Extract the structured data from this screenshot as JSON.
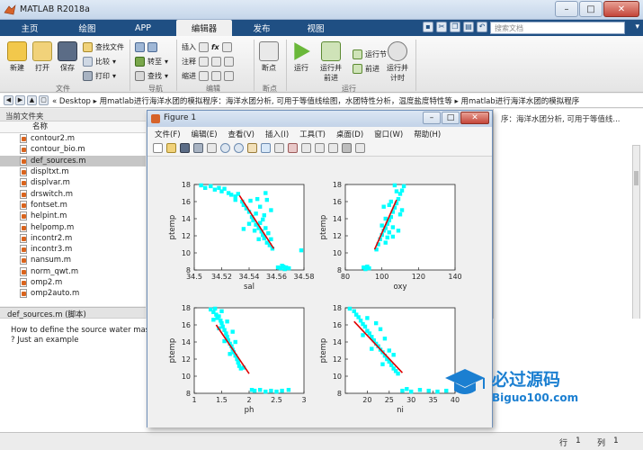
{
  "window": {
    "title": "MATLAB R2018a"
  },
  "tabs": [
    {
      "label": "主页"
    },
    {
      "label": "绘图"
    },
    {
      "label": "APP"
    },
    {
      "label": "编辑器"
    },
    {
      "label": "发布"
    },
    {
      "label": "视图"
    }
  ],
  "search": {
    "placeholder": "搜索文档"
  },
  "ribbon": {
    "file": {
      "new": "新建",
      "open": "打开",
      "save": "保存",
      "find_file": "查找文件",
      "compare": "比较",
      "print": "打印",
      "group": "文件"
    },
    "nav": {
      "goto": "转至",
      "find": "查找",
      "group": "导航"
    },
    "edit": {
      "insert": "插入",
      "comment": "注释",
      "indent": "缩进",
      "fx": "fx",
      "group": "编辑"
    },
    "breakpoint": {
      "label": "断点",
      "group": "断点"
    },
    "run": {
      "run": "运行",
      "run_advance": "运行并\n前进",
      "run_section": "运行节",
      "advance": "前进",
      "run_time": "运行并\n计时",
      "group": "运行"
    }
  },
  "address": {
    "path": "« Desktop ▸ 用matlab进行海洋水团的模拟程序：海洋水团分析, 可用于等值线绘图，水团特性分析，温度盐度特性等 ▸ 用matlab进行海洋水团的模拟程序"
  },
  "current_folder": {
    "title": "当前文件夹",
    "column": "名称",
    "files": [
      "contour2.m",
      "contour_bio.m",
      "def_sources.m",
      "displtxt.m",
      "displvar.m",
      "drswitch.m",
      "fontset.m",
      "helpint.m",
      "helpomp.m",
      "incontr2.m",
      "incontr3.m",
      "nansum.m",
      "norm_qwt.m",
      "omp2.m",
      "omp2auto.m"
    ],
    "selected_index": 2
  },
  "details": {
    "header": "def_sources.m  (脚本)",
    "lines": [
      "How to define the source water masse",
      "? Just an example"
    ]
  },
  "right_pane": {
    "text": "序：海洋水团分析, 可用于等值线..."
  },
  "status": {
    "row_label": "行",
    "row": "1",
    "col_label": "列",
    "col": "1"
  },
  "figure": {
    "title": "Figure 1",
    "menu": [
      "文件(F)",
      "编辑(E)",
      "查看(V)",
      "插入(I)",
      "工具(T)",
      "桌面(D)",
      "窗口(W)",
      "帮助(H)"
    ]
  },
  "watermark": {
    "main": "必过源码",
    "sub": "Biguo100.com"
  },
  "colors": {
    "ribbon_blue": "#1f4f83",
    "points": "#00ffff",
    "fit_line": "#e00000"
  },
  "chart_data": [
    {
      "type": "scatter",
      "xlabel": "sal",
      "ylabel": "ptemp",
      "xlim": [
        34.5,
        34.58
      ],
      "ylim": [
        8,
        18
      ],
      "xticks": [
        "34.5",
        "34.52",
        "34.54",
        "34.56",
        "34.58"
      ],
      "yticks": [
        "8",
        "10",
        "12",
        "14",
        "16",
        "18"
      ],
      "fit": [
        [
          34.533,
          16.7
        ],
        [
          34.558,
          10.5
        ]
      ],
      "points": [
        [
          34.505,
          17.9
        ],
        [
          34.508,
          17.6
        ],
        [
          34.512,
          17.8
        ],
        [
          34.515,
          17.4
        ],
        [
          34.518,
          17.6
        ],
        [
          34.52,
          17.2
        ],
        [
          34.522,
          17.5
        ],
        [
          34.525,
          17.0
        ],
        [
          34.527,
          16.8
        ],
        [
          34.53,
          16.6
        ],
        [
          34.53,
          16.2
        ],
        [
          34.532,
          16.9
        ],
        [
          34.535,
          16.0
        ],
        [
          34.536,
          15.6
        ],
        [
          34.538,
          15.2
        ],
        [
          34.54,
          14.8
        ],
        [
          34.541,
          16.1
        ],
        [
          34.542,
          14.2
        ],
        [
          34.543,
          13.8
        ],
        [
          34.545,
          13.3
        ],
        [
          34.545,
          14.6
        ],
        [
          34.547,
          12.9
        ],
        [
          34.548,
          13.5
        ],
        [
          34.549,
          12.5
        ],
        [
          34.55,
          12.1
        ],
        [
          34.55,
          13.9
        ],
        [
          34.551,
          11.7
        ],
        [
          34.552,
          12.9
        ],
        [
          34.553,
          11.2
        ],
        [
          34.554,
          12.3
        ],
        [
          34.555,
          10.9
        ],
        [
          34.556,
          11.6
        ],
        [
          34.557,
          10.5
        ],
        [
          34.548,
          15.4
        ],
        [
          34.546,
          16.3
        ],
        [
          34.552,
          17.0
        ],
        [
          34.553,
          16.2
        ],
        [
          34.556,
          15.0
        ],
        [
          34.551,
          14.4
        ],
        [
          34.544,
          12.6
        ],
        [
          34.547,
          11.6
        ],
        [
          34.54,
          13.4
        ],
        [
          34.536,
          12.8
        ],
        [
          34.561,
          8.3
        ],
        [
          34.563,
          8.2
        ],
        [
          34.565,
          8.4
        ],
        [
          34.567,
          8.3
        ],
        [
          34.569,
          8.2
        ],
        [
          34.564,
          8.5
        ],
        [
          34.566,
          8.1
        ],
        [
          34.578,
          10.3
        ]
      ]
    },
    {
      "type": "scatter",
      "xlabel": "oxy",
      "ylabel": "ptemp",
      "xlim": [
        80,
        140
      ],
      "ylim": [
        8,
        18
      ],
      "xticks": [
        "80",
        "100",
        "120",
        "140"
      ],
      "yticks": [
        "8",
        "10",
        "12",
        "14",
        "16",
        "18"
      ],
      "fit": [
        [
          96,
          10.4
        ],
        [
          108,
          16.2
        ]
      ],
      "points": [
        [
          90,
          8.3
        ],
        [
          91,
          8.1
        ],
        [
          92,
          8.4
        ],
        [
          93,
          8.2
        ],
        [
          97,
          10.4
        ],
        [
          98,
          11.0
        ],
        [
          99,
          11.6
        ],
        [
          100,
          12.1
        ],
        [
          101,
          12.6
        ],
        [
          102,
          12.9
        ],
        [
          103,
          13.4
        ],
        [
          104,
          13.8
        ],
        [
          105,
          14.2
        ],
        [
          106,
          14.8
        ],
        [
          107,
          15.3
        ],
        [
          108,
          15.8
        ],
        [
          109,
          16.3
        ],
        [
          110,
          16.9
        ],
        [
          111,
          17.3
        ],
        [
          112,
          17.8
        ],
        [
          100,
          13.2
        ],
        [
          102,
          14.0
        ],
        [
          104,
          12.4
        ],
        [
          106,
          13.0
        ],
        [
          108,
          17.2
        ],
        [
          110,
          14.5
        ],
        [
          105,
          16.0
        ],
        [
          103,
          11.8
        ],
        [
          107,
          17.9
        ],
        [
          109,
          12.6
        ],
        [
          101,
          15.4
        ],
        [
          111,
          15.0
        ],
        [
          106,
          11.9
        ],
        [
          104,
          15.6
        ],
        [
          102,
          11.2
        ]
      ]
    },
    {
      "type": "scatter",
      "xlabel": "ph",
      "ylabel": "ptemp",
      "xlim": [
        1,
        3
      ],
      "ylim": [
        8,
        18
      ],
      "xticks": [
        "1",
        "1.5",
        "2",
        "2.5",
        "3"
      ],
      "yticks": [
        "8",
        "10",
        "12",
        "14",
        "16",
        "18"
      ],
      "fit": [
        [
          1.4,
          16.0
        ],
        [
          2.0,
          10.3
        ]
      ],
      "points": [
        [
          1.3,
          17.8
        ],
        [
          1.35,
          17.5
        ],
        [
          1.38,
          17.9
        ],
        [
          1.4,
          17.2
        ],
        [
          1.42,
          16.8
        ],
        [
          1.45,
          17.0
        ],
        [
          1.48,
          16.5
        ],
        [
          1.5,
          16.2
        ],
        [
          1.52,
          15.8
        ],
        [
          1.55,
          15.4
        ],
        [
          1.58,
          15.0
        ],
        [
          1.6,
          14.6
        ],
        [
          1.62,
          14.2
        ],
        [
          1.65,
          13.8
        ],
        [
          1.68,
          13.5
        ],
        [
          1.7,
          13.1
        ],
        [
          1.72,
          12.8
        ],
        [
          1.75,
          12.4
        ],
        [
          1.78,
          12.0
        ],
        [
          1.8,
          11.6
        ],
        [
          1.82,
          11.2
        ],
        [
          1.85,
          10.9
        ],
        [
          1.6,
          16.4
        ],
        [
          1.7,
          15.2
        ],
        [
          1.55,
          14.1
        ],
        [
          1.75,
          14.0
        ],
        [
          1.45,
          15.6
        ],
        [
          1.65,
          12.6
        ],
        [
          1.9,
          11.0
        ],
        [
          1.5,
          17.6
        ],
        [
          1.35,
          16.6
        ],
        [
          2.05,
          8.4
        ],
        [
          2.1,
          8.3
        ],
        [
          2.2,
          8.4
        ],
        [
          2.3,
          8.2
        ],
        [
          2.4,
          8.3
        ],
        [
          2.5,
          8.2
        ],
        [
          2.6,
          8.3
        ],
        [
          2.72,
          8.4
        ]
      ]
    },
    {
      "type": "scatter",
      "xlabel": "ni",
      "ylabel": "ptemp",
      "xlim": [
        15,
        40
      ],
      "ylim": [
        8,
        18
      ],
      "xticks": [
        "20",
        "25",
        "30",
        "35",
        "40"
      ],
      "yticks": [
        "8",
        "10",
        "12",
        "14",
        "16",
        "18"
      ],
      "fit": [
        [
          17,
          16.4
        ],
        [
          28,
          10.4
        ]
      ],
      "points": [
        [
          16,
          17.9
        ],
        [
          17,
          17.6
        ],
        [
          17.5,
          17.2
        ],
        [
          18,
          16.9
        ],
        [
          18.5,
          16.5
        ],
        [
          19,
          16.1
        ],
        [
          19.5,
          15.8
        ],
        [
          20,
          15.3
        ],
        [
          20.5,
          15.0
        ],
        [
          21,
          14.6
        ],
        [
          21.5,
          14.2
        ],
        [
          22,
          13.8
        ],
        [
          22.5,
          13.5
        ],
        [
          23,
          13.1
        ],
        [
          23.5,
          12.8
        ],
        [
          24,
          12.4
        ],
        [
          24.5,
          12.0
        ],
        [
          25,
          11.7
        ],
        [
          25.5,
          11.3
        ],
        [
          26,
          10.9
        ],
        [
          26.5,
          10.6
        ],
        [
          27,
          10.3
        ],
        [
          20,
          16.8
        ],
        [
          22,
          16.2
        ],
        [
          23,
          15.5
        ],
        [
          24,
          14.4
        ],
        [
          21,
          13.2
        ],
        [
          25,
          13.0
        ],
        [
          26,
          12.5
        ],
        [
          19,
          14.8
        ],
        [
          23.5,
          11.4
        ],
        [
          28,
          8.3
        ],
        [
          30,
          8.2
        ],
        [
          32,
          8.4
        ],
        [
          34,
          8.3
        ],
        [
          36,
          8.2
        ],
        [
          38,
          8.3
        ],
        [
          29,
          8.5
        ]
      ]
    }
  ]
}
